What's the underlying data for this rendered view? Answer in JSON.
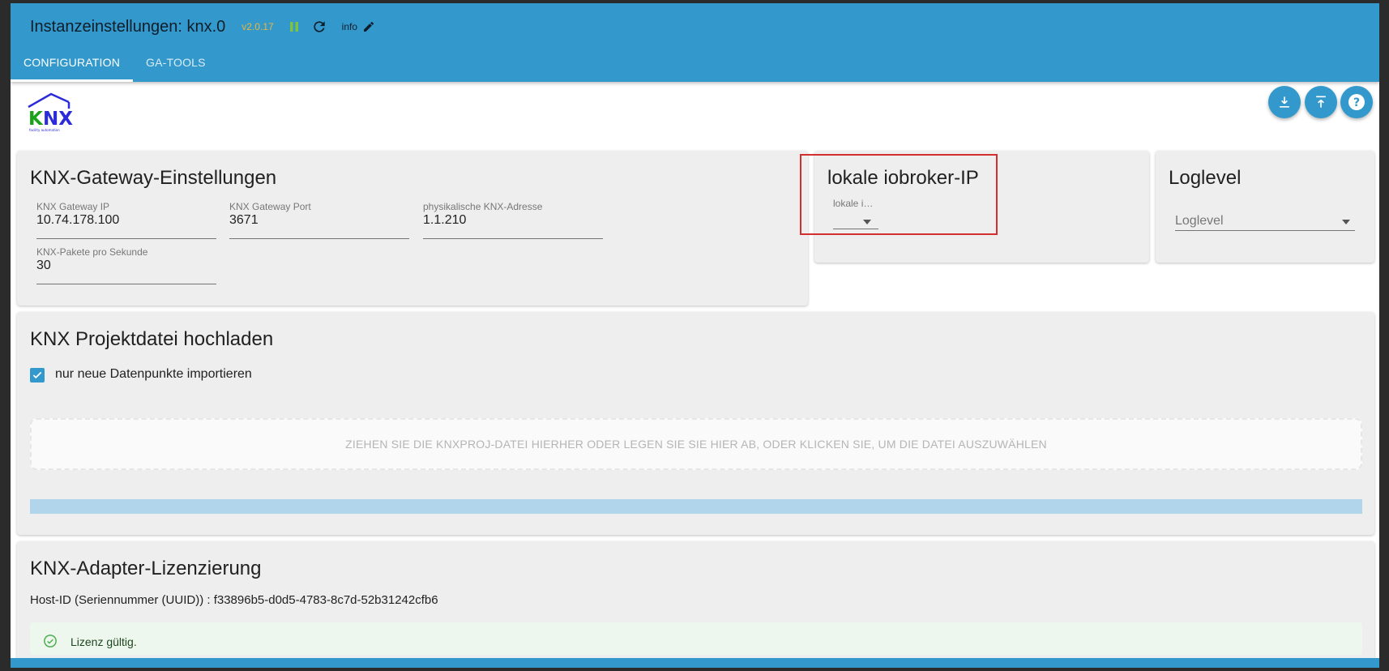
{
  "header": {
    "title": "Instanzeinstellungen: knx.0",
    "version": "v2.0.17",
    "info_label": "info",
    "tabs": [
      {
        "label": "CONFIGURATION",
        "active": true
      },
      {
        "label": "GA-TOOLS",
        "active": false
      }
    ]
  },
  "logo": {
    "text": "KNX",
    "subtext": "facility automation"
  },
  "actions": {
    "download_icon": "download-icon",
    "upload_icon": "upload-icon",
    "help_icon": "help-icon"
  },
  "gateway": {
    "title": "KNX-Gateway-Einstellungen",
    "fields": [
      {
        "label": "KNX Gateway IP",
        "value": "10.74.178.100"
      },
      {
        "label": "KNX Gateway Port",
        "value": "3671"
      },
      {
        "label": "physikalische KNX-Adresse",
        "value": "1.1.210"
      },
      {
        "label": "KNX-Pakete pro Sekunde",
        "value": "30"
      }
    ]
  },
  "local_ip": {
    "title": "lokale iobroker-IP",
    "select_label": "lokale i…"
  },
  "loglevel": {
    "title": "Loglevel",
    "placeholder": "Loglevel"
  },
  "project": {
    "title": "KNX Projektdatei hochladen",
    "checkbox_label": "nur neue Datenpunkte importieren",
    "checkbox_checked": true,
    "dropzone_text": "ZIEHEN SIE DIE KNXPROJ-DATEI HIERHER ODER LEGEN SIE SIE HIER AB, ODER KLICKEN SIE, UM DIE DATEI AUSZUWÄHLEN"
  },
  "license": {
    "title": "KNX-Adapter-Lizenzierung",
    "host_id": "Host-ID (Seriennummer (UUID)) : f33896b5-d0d5-4783-8c7d-52b31242cfb6",
    "status": "Lizenz gültig."
  },
  "colors": {
    "primary": "#3399cc",
    "version": "#e8b63a",
    "highlight": "#d32f2f",
    "success_bg": "#edf7ed"
  }
}
